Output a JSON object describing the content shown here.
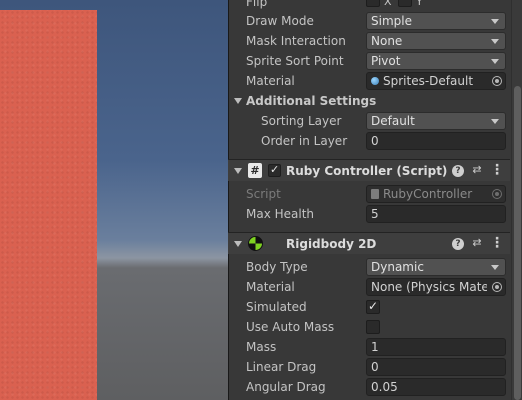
{
  "inspector": {
    "sprite_renderer": {
      "flip": {
        "label": "Flip",
        "x_label": "X",
        "y_label": "Y"
      },
      "draw_mode": {
        "label": "Draw Mode",
        "value": "Simple"
      },
      "mask_interaction": {
        "label": "Mask Interaction",
        "value": "None"
      },
      "sprite_sort_point": {
        "label": "Sprite Sort Point",
        "value": "Pivot"
      },
      "material": {
        "label": "Material",
        "value": "Sprites-Default"
      },
      "additional_settings": {
        "label": "Additional Settings",
        "sorting_layer": {
          "label": "Sorting Layer",
          "value": "Default"
        },
        "order_in_layer": {
          "label": "Order in Layer",
          "value": "0"
        }
      }
    },
    "ruby_controller": {
      "title": "Ruby Controller (Script)",
      "icon": "script-hash-icon",
      "enabled": true,
      "script": {
        "label": "Script",
        "value": "RubyController"
      },
      "max_health": {
        "label": "Max Health",
        "value": "5"
      }
    },
    "rigidbody2d": {
      "title": "Rigidbody 2D",
      "icon": "rigidbody-icon",
      "body_type": {
        "label": "Body Type",
        "value": "Dynamic"
      },
      "material": {
        "label": "Material",
        "value": "None (Physics Mater"
      },
      "simulated": {
        "label": "Simulated",
        "checked": true
      },
      "use_auto_mass": {
        "label": "Use Auto Mass",
        "checked": false
      },
      "mass": {
        "label": "Mass",
        "value": "1"
      },
      "linear_drag": {
        "label": "Linear Drag",
        "value": "0"
      },
      "angular_drag": {
        "label": "Angular Drag",
        "value": "0.05"
      }
    },
    "header_buttons": {
      "help": "?",
      "presets": "⇄",
      "menu": "⋮"
    },
    "check_glyph": "✓"
  },
  "colors": {
    "panel_bg": "#383838",
    "sprite_red": "#da6150",
    "sky_blue": "#4a648c",
    "rigidbody_green": "#7ed321"
  }
}
